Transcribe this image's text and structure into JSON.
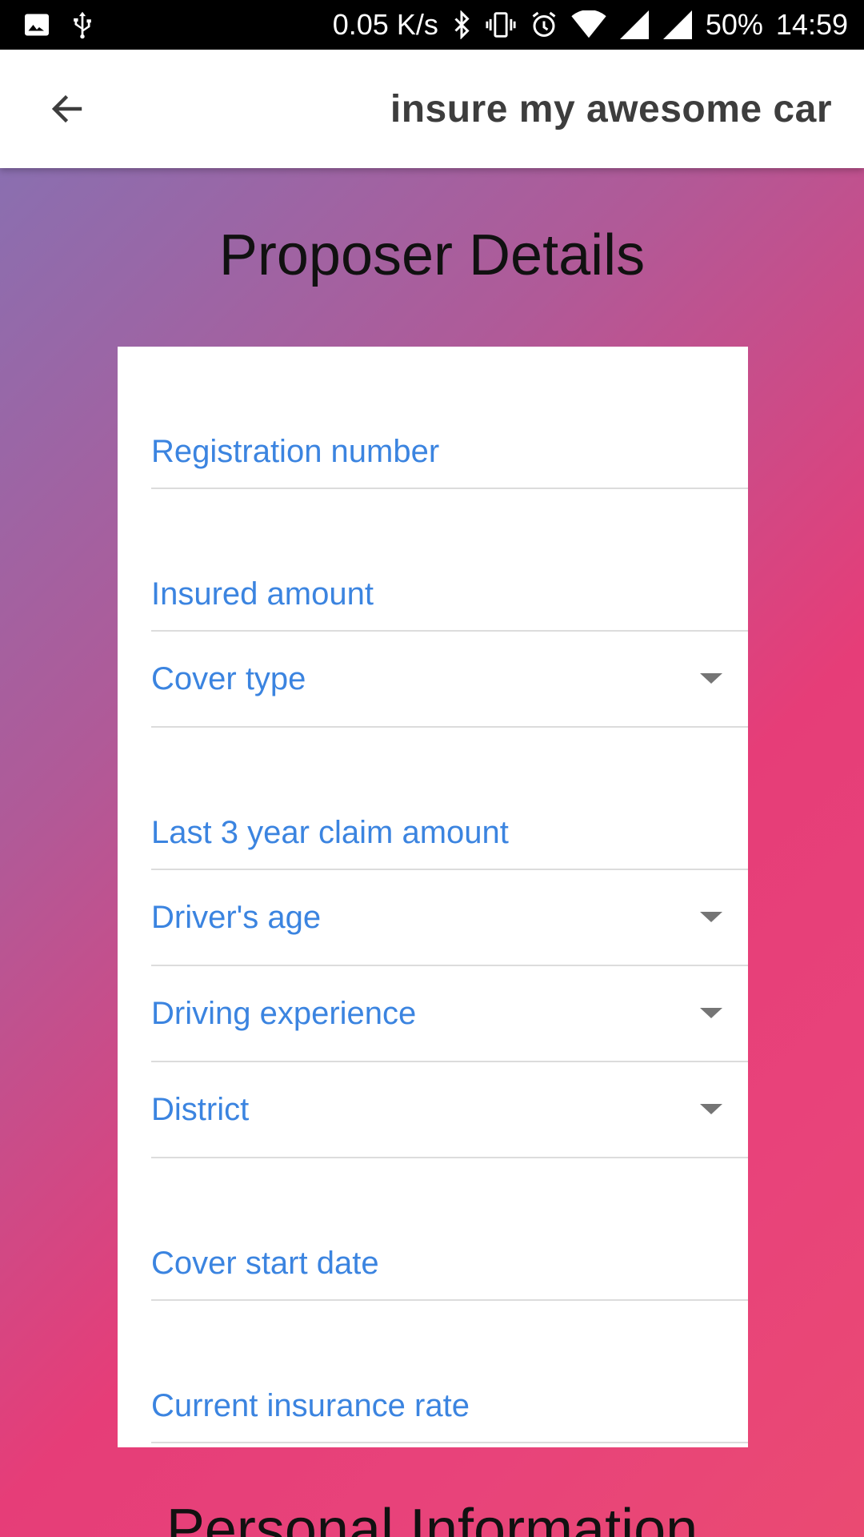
{
  "status_bar": {
    "network_speed": "0.05 K/s",
    "battery": "50%",
    "time": "14:59",
    "icons": [
      "image-icon",
      "usb-icon",
      "bluetooth-icon",
      "vibrate-icon",
      "alarm-icon",
      "wifi-icon",
      "signal-icon",
      "signal-icon"
    ]
  },
  "appbar": {
    "back_icon": "arrow-left-icon",
    "title": "insure my awesome car"
  },
  "main": {
    "section_title": "Proposer Details",
    "next_section_title": "Personal Information",
    "fields": [
      {
        "label": "Registration number",
        "type": "text"
      },
      {
        "label": "Insured amount",
        "type": "text"
      },
      {
        "label": "Cover type",
        "type": "dropdown"
      },
      {
        "label": "Last 3 year claim amount",
        "type": "text"
      },
      {
        "label": "Driver's age",
        "type": "dropdown"
      },
      {
        "label": "Driving experience",
        "type": "dropdown"
      },
      {
        "label": "District",
        "type": "dropdown"
      },
      {
        "label": "Cover start date",
        "type": "text"
      },
      {
        "label": "Current insurance rate",
        "type": "text"
      }
    ]
  },
  "colors": {
    "label_blue": "#3b84e0",
    "gradient_start": "#8a6fb0",
    "gradient_end": "#e8437a"
  }
}
